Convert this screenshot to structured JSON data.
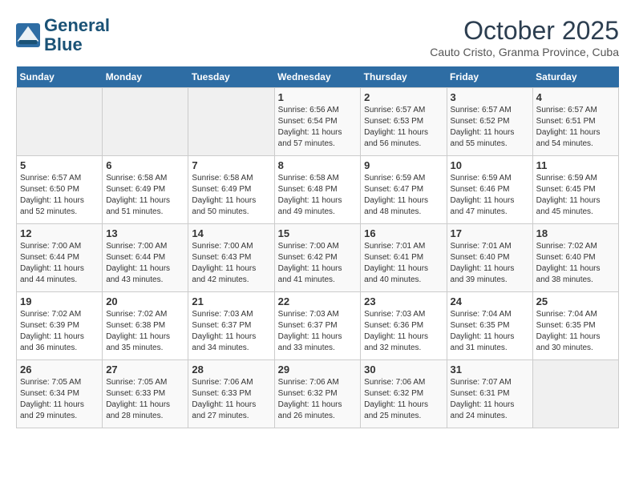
{
  "header": {
    "logo_line1": "General",
    "logo_line2": "Blue",
    "month": "October 2025",
    "location": "Cauto Cristo, Granma Province, Cuba"
  },
  "days_of_week": [
    "Sunday",
    "Monday",
    "Tuesday",
    "Wednesday",
    "Thursday",
    "Friday",
    "Saturday"
  ],
  "weeks": [
    [
      {
        "day": "",
        "info": ""
      },
      {
        "day": "",
        "info": ""
      },
      {
        "day": "",
        "info": ""
      },
      {
        "day": "1",
        "info": "Sunrise: 6:56 AM\nSunset: 6:54 PM\nDaylight: 11 hours\nand 57 minutes."
      },
      {
        "day": "2",
        "info": "Sunrise: 6:57 AM\nSunset: 6:53 PM\nDaylight: 11 hours\nand 56 minutes."
      },
      {
        "day": "3",
        "info": "Sunrise: 6:57 AM\nSunset: 6:52 PM\nDaylight: 11 hours\nand 55 minutes."
      },
      {
        "day": "4",
        "info": "Sunrise: 6:57 AM\nSunset: 6:51 PM\nDaylight: 11 hours\nand 54 minutes."
      }
    ],
    [
      {
        "day": "5",
        "info": "Sunrise: 6:57 AM\nSunset: 6:50 PM\nDaylight: 11 hours\nand 52 minutes."
      },
      {
        "day": "6",
        "info": "Sunrise: 6:58 AM\nSunset: 6:49 PM\nDaylight: 11 hours\nand 51 minutes."
      },
      {
        "day": "7",
        "info": "Sunrise: 6:58 AM\nSunset: 6:49 PM\nDaylight: 11 hours\nand 50 minutes."
      },
      {
        "day": "8",
        "info": "Sunrise: 6:58 AM\nSunset: 6:48 PM\nDaylight: 11 hours\nand 49 minutes."
      },
      {
        "day": "9",
        "info": "Sunrise: 6:59 AM\nSunset: 6:47 PM\nDaylight: 11 hours\nand 48 minutes."
      },
      {
        "day": "10",
        "info": "Sunrise: 6:59 AM\nSunset: 6:46 PM\nDaylight: 11 hours\nand 47 minutes."
      },
      {
        "day": "11",
        "info": "Sunrise: 6:59 AM\nSunset: 6:45 PM\nDaylight: 11 hours\nand 45 minutes."
      }
    ],
    [
      {
        "day": "12",
        "info": "Sunrise: 7:00 AM\nSunset: 6:44 PM\nDaylight: 11 hours\nand 44 minutes."
      },
      {
        "day": "13",
        "info": "Sunrise: 7:00 AM\nSunset: 6:44 PM\nDaylight: 11 hours\nand 43 minutes."
      },
      {
        "day": "14",
        "info": "Sunrise: 7:00 AM\nSunset: 6:43 PM\nDaylight: 11 hours\nand 42 minutes."
      },
      {
        "day": "15",
        "info": "Sunrise: 7:00 AM\nSunset: 6:42 PM\nDaylight: 11 hours\nand 41 minutes."
      },
      {
        "day": "16",
        "info": "Sunrise: 7:01 AM\nSunset: 6:41 PM\nDaylight: 11 hours\nand 40 minutes."
      },
      {
        "day": "17",
        "info": "Sunrise: 7:01 AM\nSunset: 6:40 PM\nDaylight: 11 hours\nand 39 minutes."
      },
      {
        "day": "18",
        "info": "Sunrise: 7:02 AM\nSunset: 6:40 PM\nDaylight: 11 hours\nand 38 minutes."
      }
    ],
    [
      {
        "day": "19",
        "info": "Sunrise: 7:02 AM\nSunset: 6:39 PM\nDaylight: 11 hours\nand 36 minutes."
      },
      {
        "day": "20",
        "info": "Sunrise: 7:02 AM\nSunset: 6:38 PM\nDaylight: 11 hours\nand 35 minutes."
      },
      {
        "day": "21",
        "info": "Sunrise: 7:03 AM\nSunset: 6:37 PM\nDaylight: 11 hours\nand 34 minutes."
      },
      {
        "day": "22",
        "info": "Sunrise: 7:03 AM\nSunset: 6:37 PM\nDaylight: 11 hours\nand 33 minutes."
      },
      {
        "day": "23",
        "info": "Sunrise: 7:03 AM\nSunset: 6:36 PM\nDaylight: 11 hours\nand 32 minutes."
      },
      {
        "day": "24",
        "info": "Sunrise: 7:04 AM\nSunset: 6:35 PM\nDaylight: 11 hours\nand 31 minutes."
      },
      {
        "day": "25",
        "info": "Sunrise: 7:04 AM\nSunset: 6:35 PM\nDaylight: 11 hours\nand 30 minutes."
      }
    ],
    [
      {
        "day": "26",
        "info": "Sunrise: 7:05 AM\nSunset: 6:34 PM\nDaylight: 11 hours\nand 29 minutes."
      },
      {
        "day": "27",
        "info": "Sunrise: 7:05 AM\nSunset: 6:33 PM\nDaylight: 11 hours\nand 28 minutes."
      },
      {
        "day": "28",
        "info": "Sunrise: 7:06 AM\nSunset: 6:33 PM\nDaylight: 11 hours\nand 27 minutes."
      },
      {
        "day": "29",
        "info": "Sunrise: 7:06 AM\nSunset: 6:32 PM\nDaylight: 11 hours\nand 26 minutes."
      },
      {
        "day": "30",
        "info": "Sunrise: 7:06 AM\nSunset: 6:32 PM\nDaylight: 11 hours\nand 25 minutes."
      },
      {
        "day": "31",
        "info": "Sunrise: 7:07 AM\nSunset: 6:31 PM\nDaylight: 11 hours\nand 24 minutes."
      },
      {
        "day": "",
        "info": ""
      }
    ]
  ]
}
